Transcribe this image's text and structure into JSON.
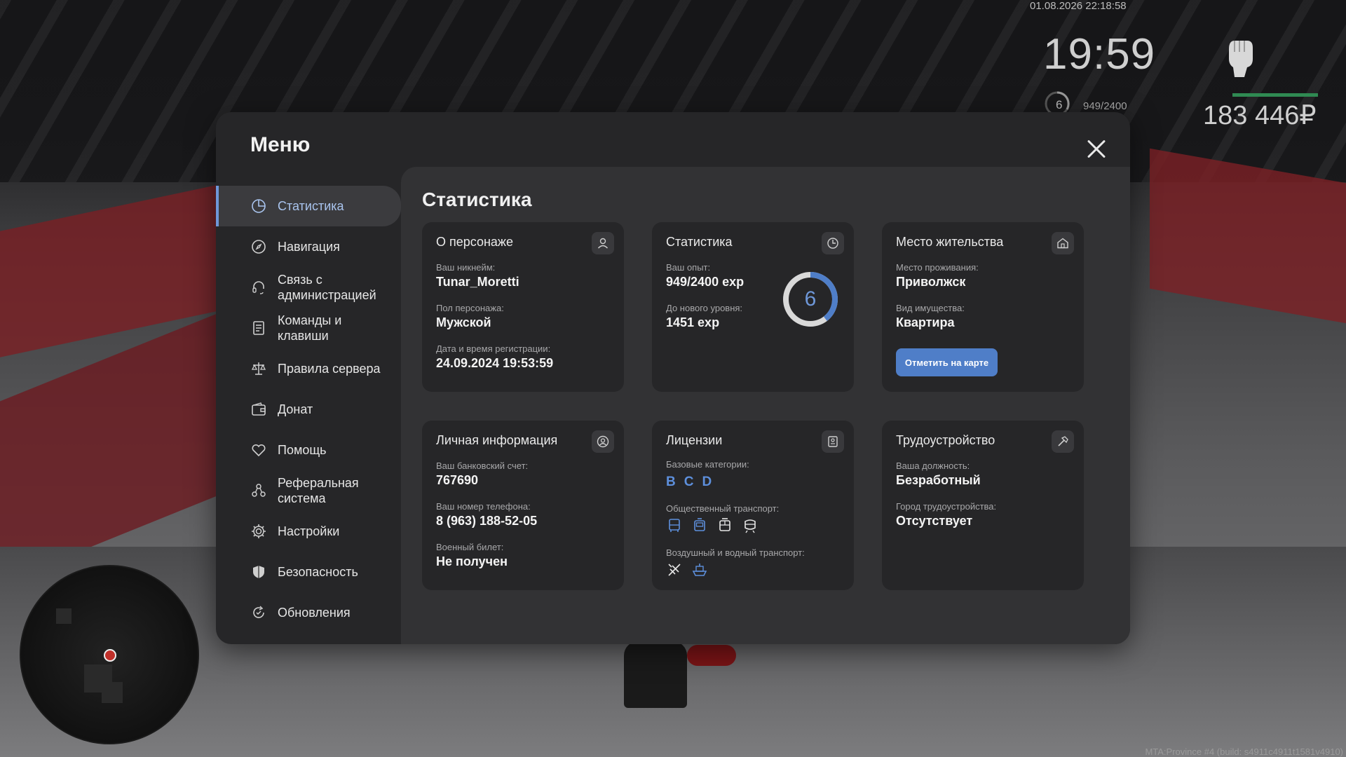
{
  "hud": {
    "datetime": "01.08.2026 22:18:58",
    "time": "19:59",
    "level": "6",
    "exp": "949/2400",
    "money": "183 446₽",
    "watermark": "MTA:Province #4 (build: s4911c4911t1581v4910)"
  },
  "menu": {
    "title": "Меню",
    "sidebar": [
      {
        "label": "Статистика",
        "icon": "pie-chart-icon",
        "active": true
      },
      {
        "label": "Навигация",
        "icon": "compass-icon"
      },
      {
        "label": "Связь с администрацией",
        "icon": "headset-icon"
      },
      {
        "label": "Команды и клавиши",
        "icon": "document-icon"
      },
      {
        "label": "Правила сервера",
        "icon": "scales-icon"
      },
      {
        "label": "Донат",
        "icon": "wallet-icon"
      },
      {
        "label": "Помощь",
        "icon": "heart-hand-icon"
      },
      {
        "label": "Реферальная система",
        "icon": "referral-icon"
      },
      {
        "label": "Настройки",
        "icon": "gear-icon"
      },
      {
        "label": "Безопасность",
        "icon": "shield-icon"
      },
      {
        "label": "Обновления",
        "icon": "refresh-icon"
      }
    ],
    "accent_color": "#6e97d8"
  },
  "stats": {
    "title": "Статистика",
    "character": {
      "title": "О персонаже",
      "nickname_label": "Ваш никнейм:",
      "nickname": "Tunar_Moretti",
      "gender_label": "Пол персонажа:",
      "gender": "Мужской",
      "reg_label": "Дата и время регистрации:",
      "reg": "24.09.2024 19:53:59"
    },
    "statistics": {
      "title": "Статистика",
      "exp_label": "Ваш опыт:",
      "exp": "949/2400 exp",
      "next_label": "До нового уровня:",
      "next": "1451 exp",
      "level": "6",
      "progress": 0.395
    },
    "residence": {
      "title": "Место жительства",
      "place_label": "Место проживания:",
      "place": "Приволжск",
      "property_label": "Вид имущества:",
      "property": "Квартира",
      "button": "Отметить на карте"
    },
    "personal": {
      "title": "Личная информация",
      "bank_label": "Ваш банковский счет:",
      "bank": "767690",
      "phone_label": "Ваш номер телефона:",
      "phone": "8 (963) 188-52-05",
      "military_label": "Военный билет:",
      "military": "Не получен"
    },
    "licenses": {
      "title": "Лицензии",
      "base_label": "Базовые категории:",
      "categories": [
        "B",
        "C",
        "D"
      ],
      "public_label": "Общественный транспорт:",
      "public_icons": [
        "bus-icon",
        "trolleybus-icon",
        "tram-icon",
        "train-icon"
      ],
      "air_label": "Воздушный и водный транспорт:",
      "air_icons": [
        "plane-icon",
        "boat-icon"
      ]
    },
    "employment": {
      "title": "Трудоустройство",
      "position_label": "Ваша должность:",
      "position": "Безработный",
      "city_label": "Город трудоустройства:",
      "city": "Отсутствует"
    }
  }
}
